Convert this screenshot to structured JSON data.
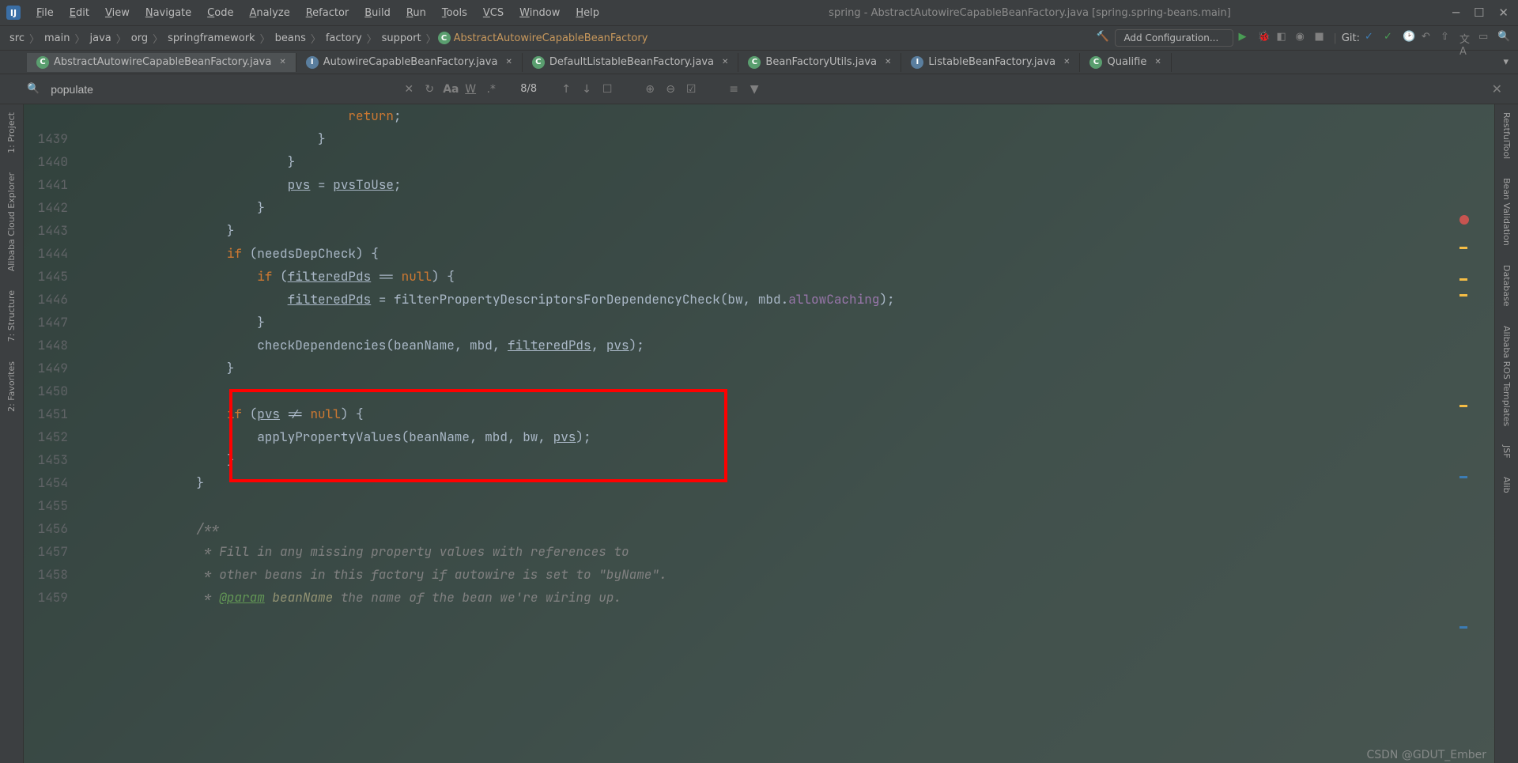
{
  "menu": [
    "File",
    "Edit",
    "View",
    "Navigate",
    "Code",
    "Analyze",
    "Refactor",
    "Build",
    "Run",
    "Tools",
    "VCS",
    "Window",
    "Help"
  ],
  "window_title": "spring - AbstractAutowireCapableBeanFactory.java [spring.spring-beans.main]",
  "breadcrumbs": [
    "src",
    "main",
    "java",
    "org",
    "springframework",
    "beans",
    "factory",
    "support"
  ],
  "breadcrumb_class": "AbstractAutowireCapableBeanFactory",
  "run_config": "Add Configuration...",
  "git_label": "Git:",
  "tabs": [
    {
      "icon": "c",
      "label": "AbstractAutowireCapableBeanFactory.java",
      "active": true
    },
    {
      "icon": "i",
      "label": "AutowireCapableBeanFactory.java",
      "active": false
    },
    {
      "icon": "c",
      "label": "DefaultListableBeanFactory.java",
      "active": false
    },
    {
      "icon": "c",
      "label": "BeanFactoryUtils.java",
      "active": false
    },
    {
      "icon": "i",
      "label": "ListableBeanFactory.java",
      "active": false
    },
    {
      "icon": "c",
      "label": "Qualifie",
      "active": false
    }
  ],
  "find_text": "populate",
  "find_count": "8/8",
  "left_tools": [
    "1: Project",
    "Alibaba Cloud Explorer",
    "7: Structure",
    "2: Favorites"
  ],
  "right_tools": [
    "RestfulTool",
    "Bean Validation",
    "Database",
    "Alibaba ROS Templates",
    "JSF",
    "Alib"
  ],
  "code": [
    {
      "n": "1439",
      "t": "                    }"
    },
    {
      "n": "1440",
      "t": "                }"
    },
    {
      "n": "1441",
      "html": "                <span class='ul'>pvs</span> = <span class='ul'>pvsToUse</span>;"
    },
    {
      "n": "1442",
      "t": "            }"
    },
    {
      "n": "1443",
      "t": "        }"
    },
    {
      "n": "1444",
      "html": "        <span class='kw'>if</span> (needsDepCheck) {"
    },
    {
      "n": "1445",
      "html": "            <span class='kw'>if</span> (<span class='ul'>filteredPds</span> == <span class='kw'>null</span>) {"
    },
    {
      "n": "1446",
      "html": "                <span class='ul'>filteredPds</span> = filterPropertyDescriptorsForDependencyCheck(bw, mbd.<span class='field'>allowCaching</span>);"
    },
    {
      "n": "1447",
      "t": "            }"
    },
    {
      "n": "1448",
      "html": "            checkDependencies(beanName, mbd, <span class='ul'>filteredPds</span>, <span class='ul'>pvs</span>);"
    },
    {
      "n": "1449",
      "t": "        }"
    },
    {
      "n": "1450",
      "t": ""
    },
    {
      "n": "1451",
      "html": "        <span class='kw'>if</span> (<span class='ul'>pvs</span> != <span class='kw'>null</span>) {"
    },
    {
      "n": "1452",
      "html": "            applyPropertyValues(beanName, mbd, bw, <span class='ul'>pvs</span>);"
    },
    {
      "n": "1453",
      "t": "        }"
    },
    {
      "n": "1454",
      "t": "    }"
    },
    {
      "n": "1455",
      "t": ""
    },
    {
      "n": "1456",
      "html": "    <span class='comment'>/**</span>"
    },
    {
      "n": "1457",
      "html": "<span class='comment'>     * Fill in any missing property values with references to</span>"
    },
    {
      "n": "1458",
      "html": "<span class='comment'>     * other beans in this factory if autowire is set to \"byName\".</span>"
    },
    {
      "n": "1459",
      "html": "<span class='comment'>     * <span class='doctag'>@param</span> <span class='docparam'>beanName</span> the name of the bean we're wiring up.</span>"
    }
  ],
  "watermark": "CSDN @GDUT_Ember"
}
